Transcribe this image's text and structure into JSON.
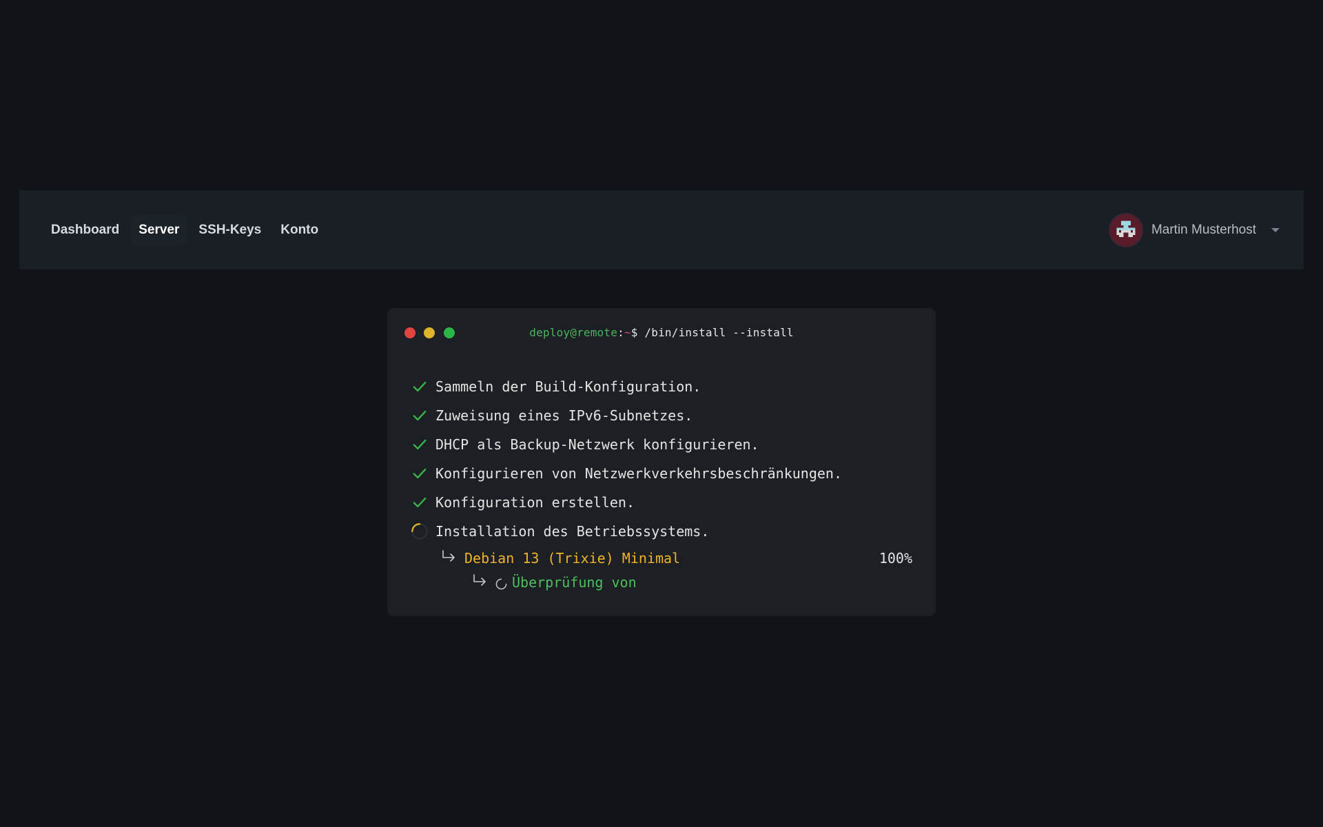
{
  "nav": {
    "items": [
      {
        "label": "Dashboard",
        "active": false
      },
      {
        "label": "Server",
        "active": true
      },
      {
        "label": "SSH-Keys",
        "active": false
      },
      {
        "label": "Konto",
        "active": false
      }
    ],
    "user": {
      "name": "Martin Musterhost"
    }
  },
  "terminal": {
    "prompt": {
      "user_host": "deploy@remote",
      "colon": ":",
      "path": "~",
      "symbol": "$",
      "command": " /bin/install --install"
    },
    "steps": [
      {
        "text": "Sammeln der Build-Konfiguration.",
        "status": "done"
      },
      {
        "text": "Zuweisung eines IPv6-Subnetzes.",
        "status": "done"
      },
      {
        "text": "DHCP als Backup-Netzwerk konfigurieren.",
        "status": "done"
      },
      {
        "text": "Konfigurieren von Netzwerkverkehrsbeschränkungen.",
        "status": "done"
      },
      {
        "text": "Konfiguration erstellen.",
        "status": "done"
      },
      {
        "text": "Installation des Betriebssystems.",
        "status": "in-progress"
      }
    ],
    "os": {
      "name": "Debian 13 (Trixie) Minimal",
      "progress": "100%"
    },
    "substatus": "Überprüfung von"
  },
  "colors": {
    "background": "#101418",
    "navbar": "#1a1e25",
    "terminal": "#1c1f24",
    "check": "#39b54a",
    "os_name": "#f0b429",
    "verify": "#4cc15a"
  }
}
